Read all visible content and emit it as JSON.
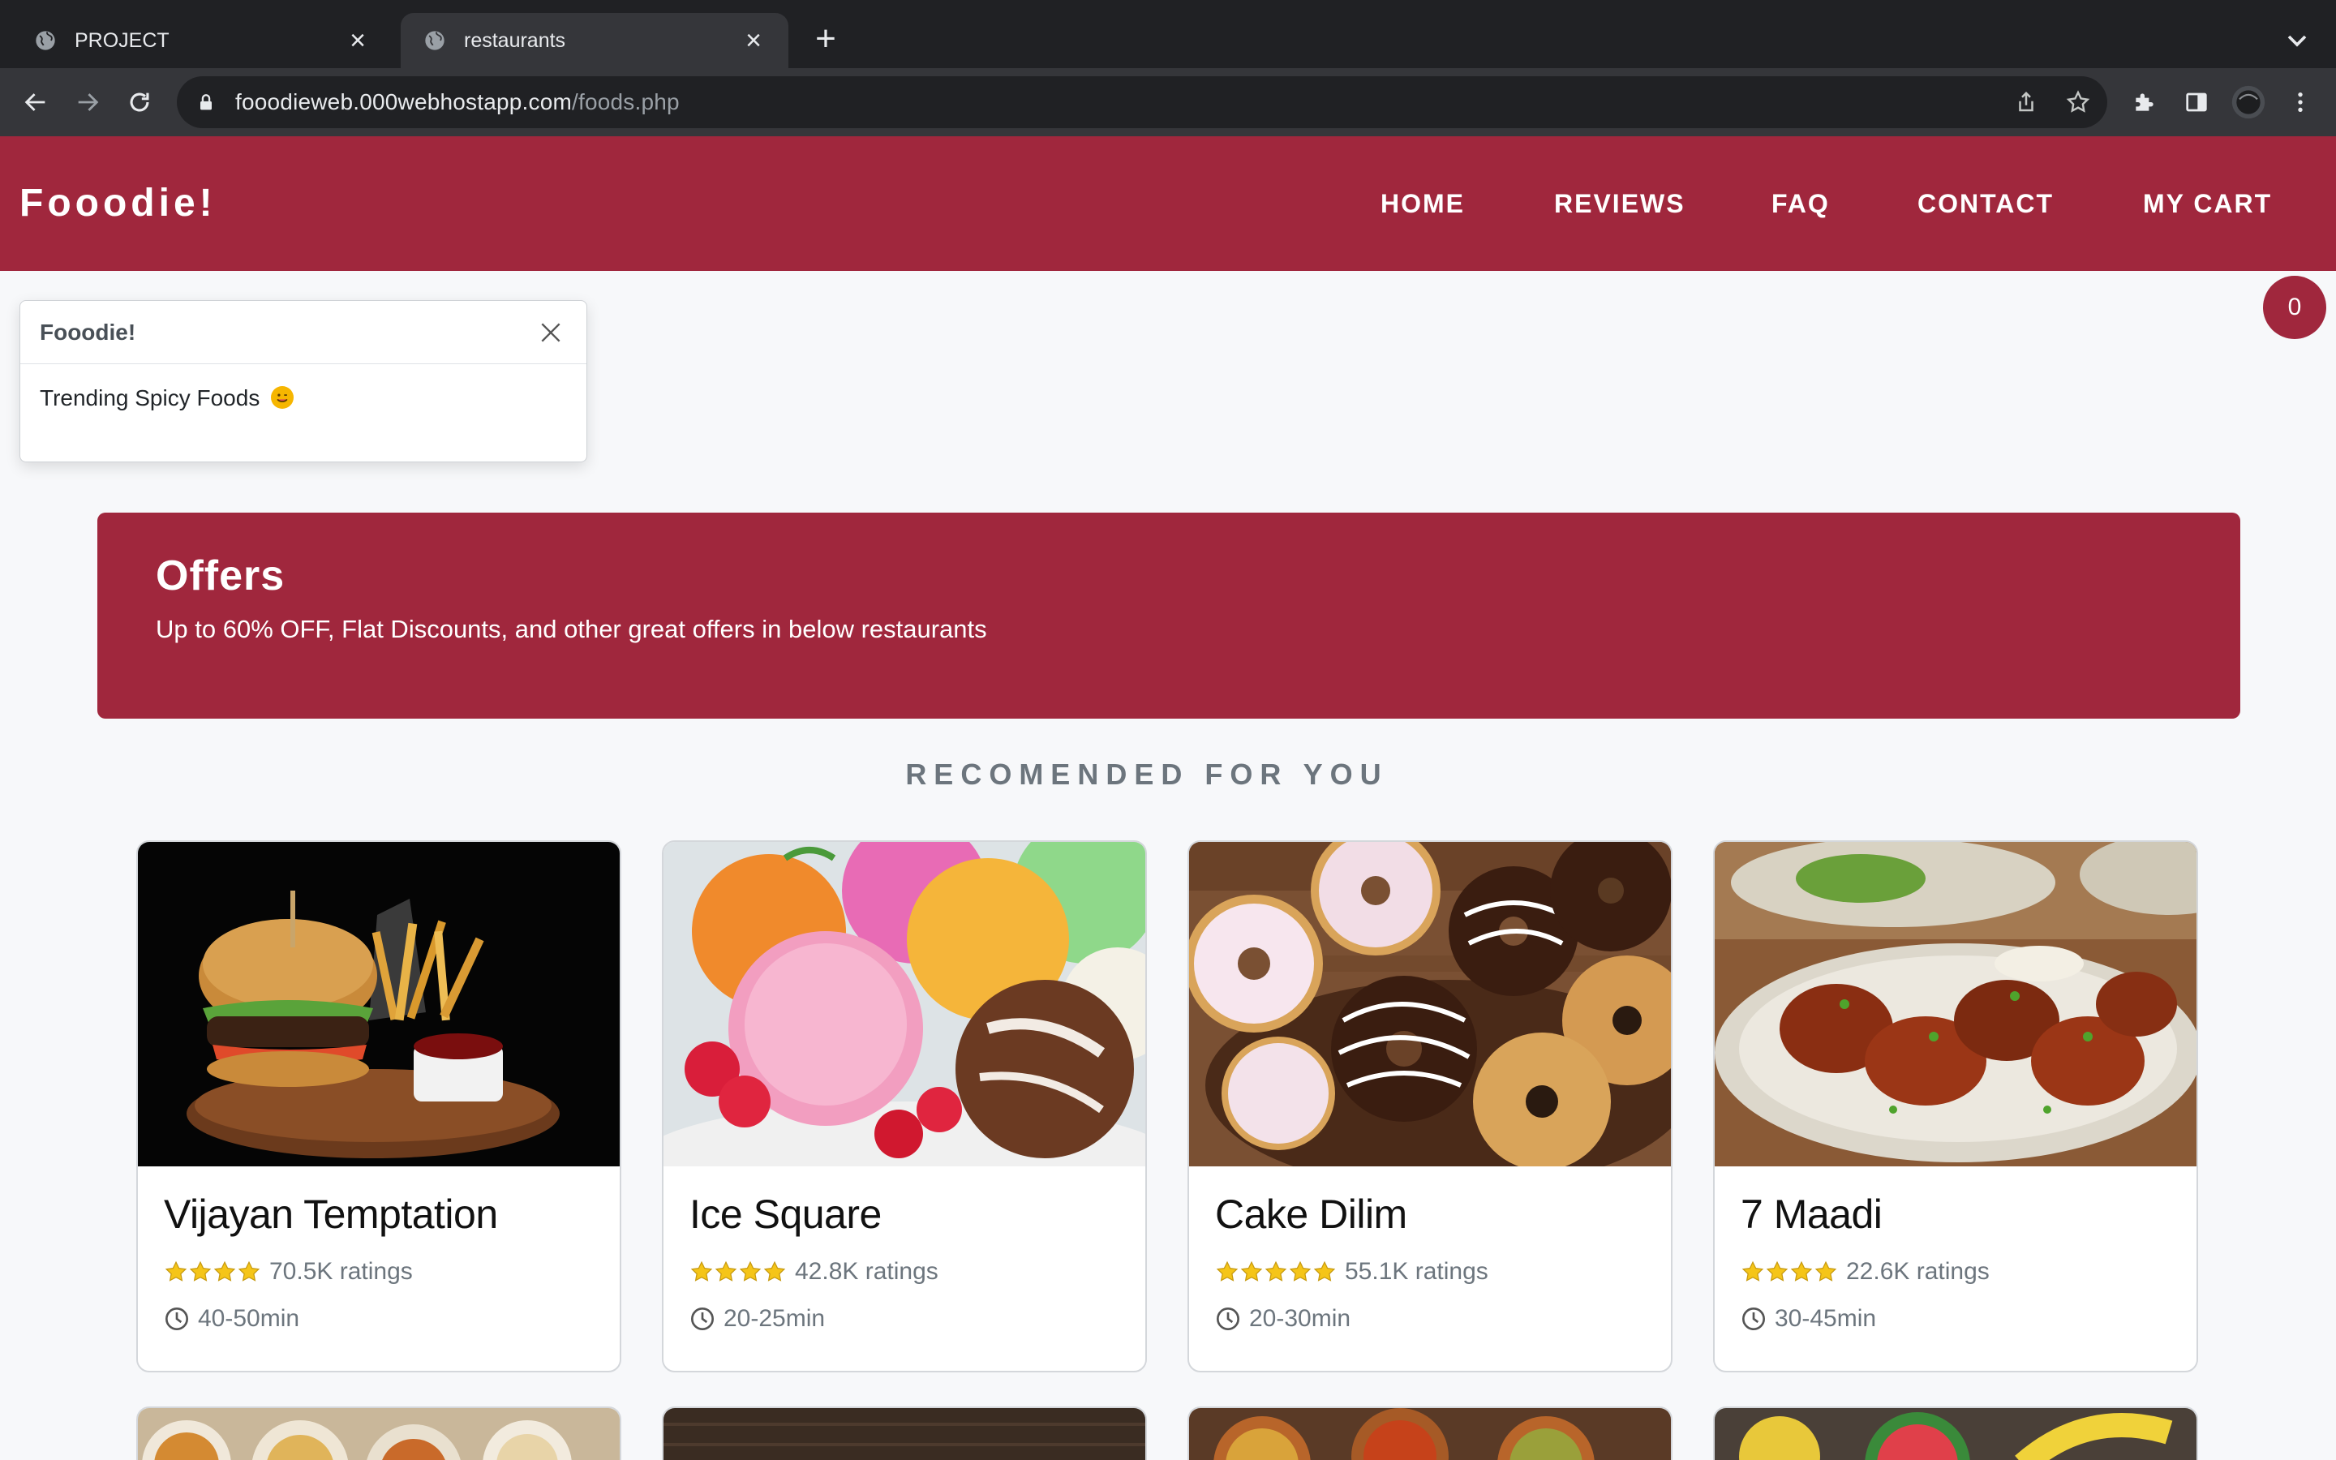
{
  "browser": {
    "tabs": [
      {
        "title": "PROJECT",
        "active": false
      },
      {
        "title": "restaurants",
        "active": true
      }
    ],
    "url_domain": "fooodieweb.000webhostapp.com",
    "url_path": "/foods.php"
  },
  "site": {
    "brand": "Fooodie!",
    "nav": [
      "HOME",
      "REVIEWS",
      "FAQ",
      "CONTACT",
      "MY CART"
    ],
    "cart_count": "0"
  },
  "toast": {
    "title": "Fooodie!",
    "message": "Trending Spicy Foods"
  },
  "offers": {
    "heading": "Offers",
    "text": "Up to 60% OFF, Flat Discounts, and other great offers in below restaurants"
  },
  "section_title": "RECOMENDED FOR YOU",
  "restaurants": [
    {
      "name": "Vijayan Temptation",
      "ratings": "70.5K ratings",
      "stars": 4,
      "time": "40-50min"
    },
    {
      "name": "Ice Square",
      "ratings": "42.8K ratings",
      "stars": 4,
      "time": "20-25min"
    },
    {
      "name": "Cake Dilim",
      "ratings": "55.1K ratings",
      "stars": 5,
      "time": "20-30min"
    },
    {
      "name": "7 Maadi",
      "ratings": "22.6K ratings",
      "stars": 4,
      "time": "30-45min"
    }
  ],
  "colors": {
    "brand": "#a0273d",
    "chrome_dark": "#202124",
    "chrome_mid": "#35363a",
    "star": "#f5c518"
  }
}
